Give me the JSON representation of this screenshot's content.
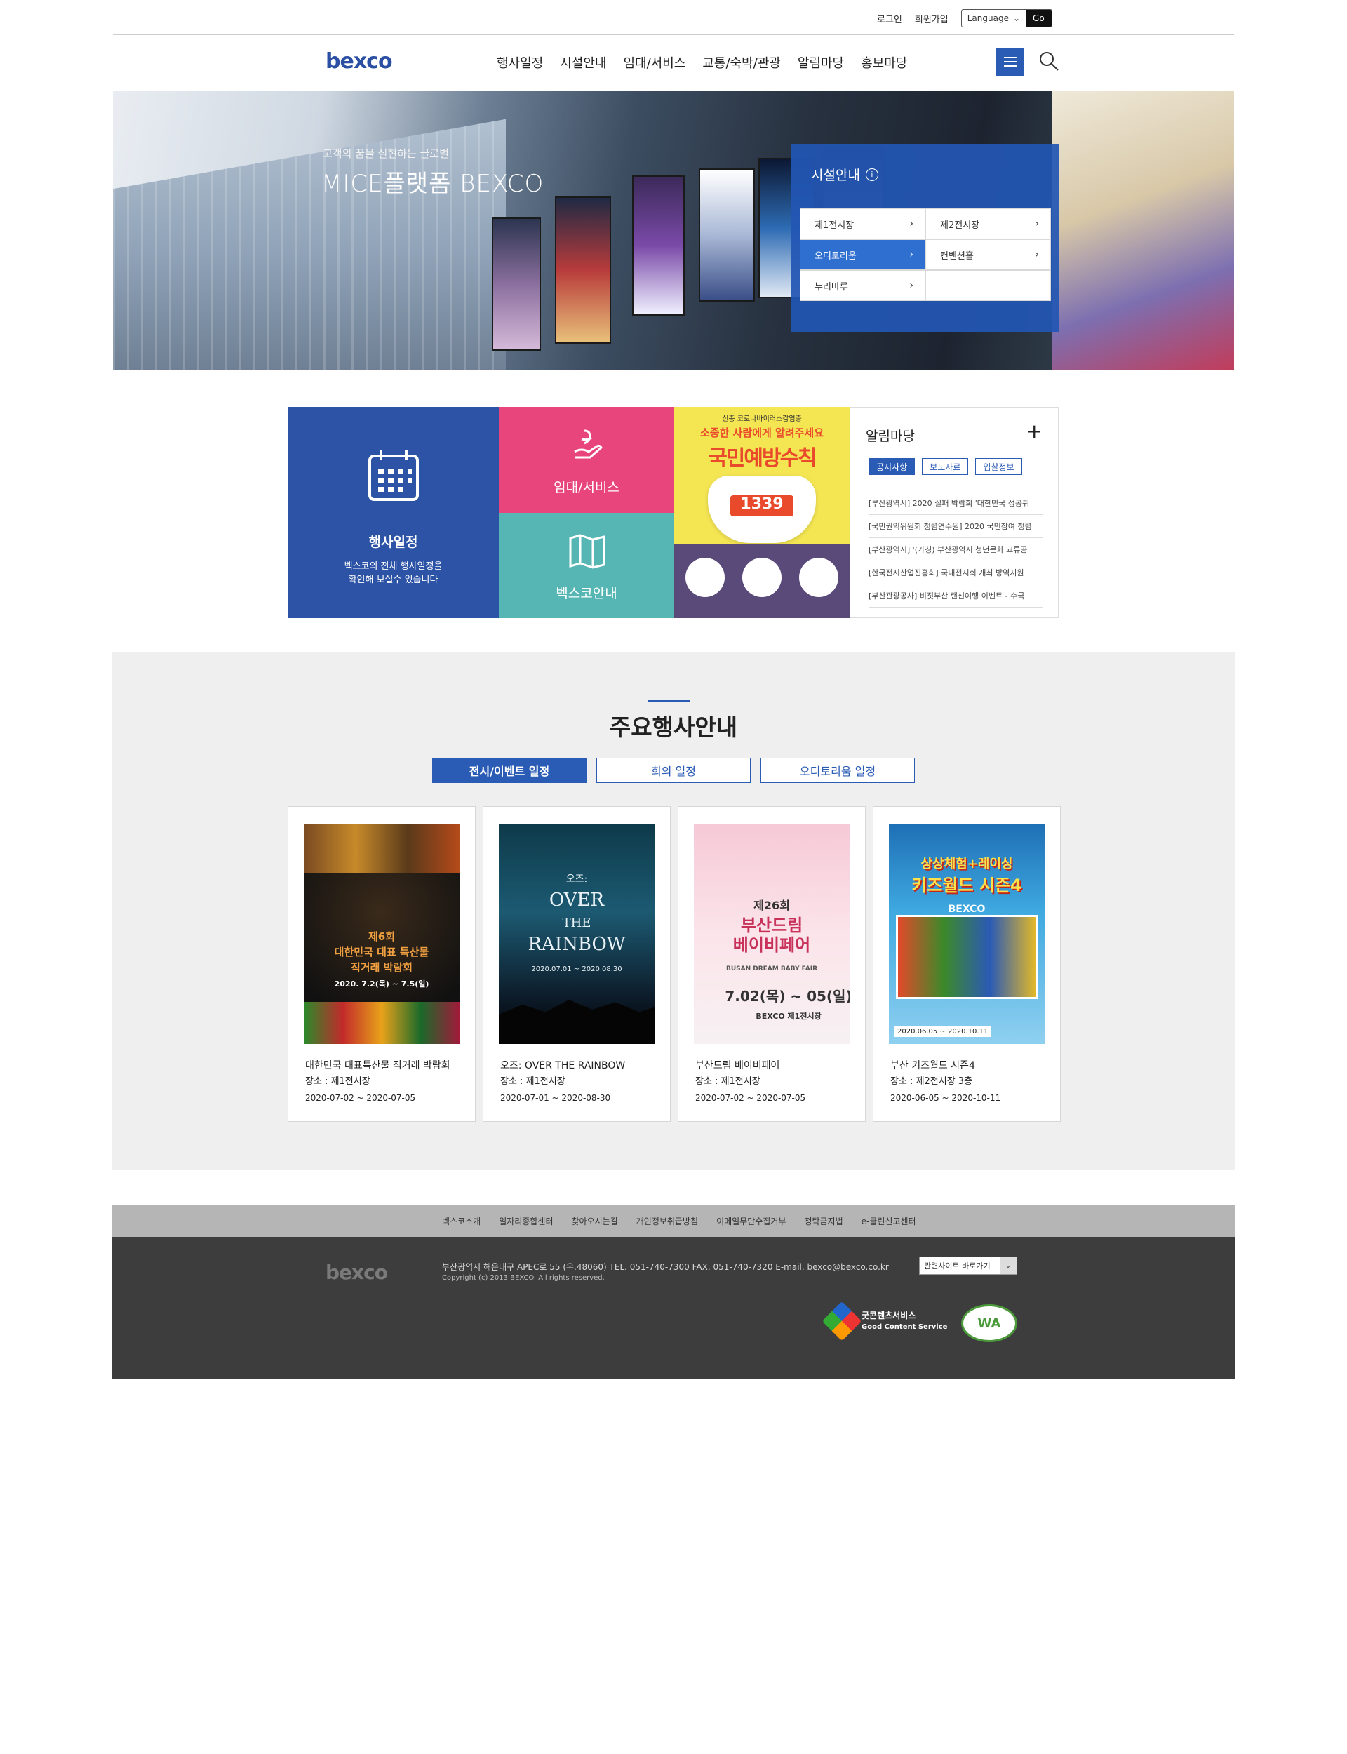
{
  "utility": {
    "login": "로그인",
    "signup": "회원가입",
    "language": "Language",
    "go": "Go"
  },
  "header": {
    "logo": "bexco",
    "nav": [
      "행사일정",
      "시설안내",
      "임대/서비스",
      "교통/숙박/관광",
      "알림마당",
      "홍보마당"
    ]
  },
  "hero": {
    "subtitle": "고객의 꿈을 실현하는 글로벌",
    "title": "MICE플랫폼 BEXCO",
    "facility": {
      "title": "시설안내",
      "items": [
        {
          "label": "제1전시장",
          "active": false
        },
        {
          "label": "제2전시장",
          "active": false
        },
        {
          "label": "오디토리움",
          "active": true
        },
        {
          "label": "컨벤션홀",
          "active": false
        },
        {
          "label": "누리마루",
          "active": false
        },
        {
          "label": "",
          "active": false
        }
      ]
    }
  },
  "quick": {
    "schedule": {
      "title": "행사일정",
      "desc1": "벡스코의 전체 행사일정을",
      "desc2": "확인해 보실수 있습니다"
    },
    "rent": {
      "title": "임대/서비스"
    },
    "guide": {
      "title": "벡스코안내"
    },
    "poster": {
      "top": "신종 코로나바이러스감염증",
      "line1": "소중한 사람에게 알려주세요",
      "line2": "국민예방수칙",
      "number": "1339"
    }
  },
  "notice": {
    "title": "알림마당",
    "tabs": [
      "공지사항",
      "보도자료",
      "입찰정보"
    ],
    "items": [
      "[부산광역시] 2020 실패 박람회 '대한민국 성공퀴",
      "[국민권익위원회 청렴연수원] 2020 국민참여 청렴",
      "[부산광역시] '(가칭) 부산광역시 청년문화 교류공",
      "[한국전시산업진흥회] 국내전시회 개최 방역지원",
      "[부산관광공사] 비짓부산 랜선여행 이벤트 - 수국"
    ]
  },
  "events": {
    "title": "주요행사안내",
    "tabs": [
      "전시/이벤트 일정",
      "회의 일정",
      "오디토리움 일정"
    ],
    "cards": [
      {
        "title": "대한민국 대표특산물 직거래 박람회",
        "place": "장소 : 제1전시장",
        "date": "2020-07-02 ~ 2020-07-05",
        "poster": [
          "제6회",
          "대한민국 대표 특산물",
          "직거래 박람회",
          "2020. 7.2(목) ~ 7.5(일)"
        ]
      },
      {
        "title": "오즈: OVER THE RAINBOW",
        "place": "장소 : 제1전시장",
        "date": "2020-07-01 ~ 2020-08-30",
        "poster": [
          "오즈:",
          "OVER",
          "THE",
          "RAINBOW",
          "2020.07.01 ~ 2020.08.30"
        ]
      },
      {
        "title": "부산드림 베이비페어",
        "place": "장소 : 제1전시장",
        "date": "2020-07-02 ~ 2020-07-05",
        "poster": [
          "제26회",
          "부산드림",
          "베이비페어",
          "BUSAN DREAM BABY FAIR",
          "7.02(목) ~ 05(일)",
          "BEXCO 제1전시장"
        ]
      },
      {
        "title": "부산 키즈월드 시즌4",
        "place": "장소 : 제2전시장 3층",
        "date": "2020-06-05 ~ 2020-10-11",
        "poster": [
          "상상체험+레이싱",
          "키즈월드 시즌4",
          "BEXCO",
          "2020.06.05 ~ 2020.10.11"
        ]
      }
    ]
  },
  "footer": {
    "links": [
      "벡스코소개",
      "일자리종합센터",
      "찾아오시는길",
      "개인정보취급방침",
      "이메일무단수집거부",
      "청탁금지법",
      "e-클린신고센터"
    ],
    "logo": "bexco",
    "address": "부산광역시 해운대구 APEC로 55 (우.48060) TEL. 051-740-7300 FAX. 051-740-7320 E-mail. bexco@bexco.co.kr",
    "copyright": "Copyright (c) 2013 BEXCO. All rights reserved.",
    "related": "관련사이트 바로가기",
    "gcs": [
      "굿콘텐츠서비스",
      "Good Content Service"
    ],
    "wa": "WA"
  },
  "colors": {
    "brand": "#2a5bb5",
    "pink": "#e8457c",
    "teal": "#56b6b4",
    "footer": "#3d3d3d"
  }
}
